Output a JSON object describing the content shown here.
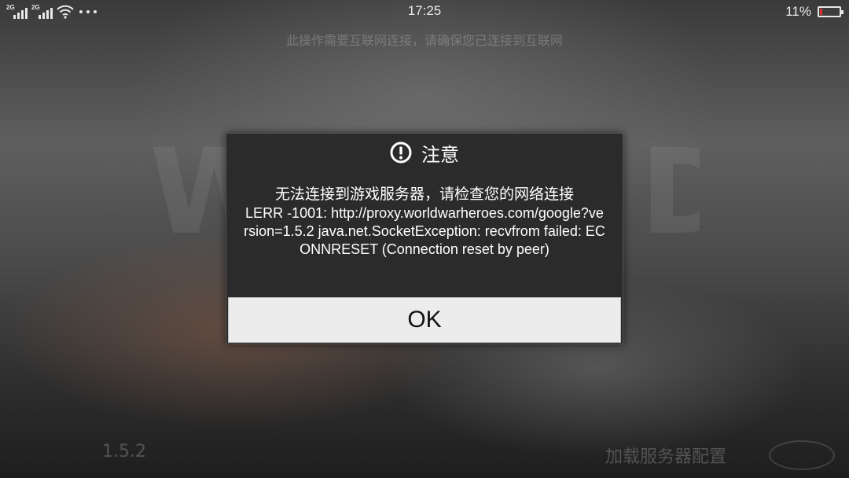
{
  "status_bar": {
    "sim1_network": "2G",
    "sim2_network": "2G",
    "time": "17:25",
    "battery_percent_text": "11%",
    "battery_level": 0.11,
    "battery_color": "#e0302a"
  },
  "background": {
    "notice": "此操作需要互联网连接，请确保您已连接到互联网",
    "watermark": "WORLD WAR",
    "version": "1.5.2",
    "loading_text": "加载服务器配置"
  },
  "dialog": {
    "icon": "alert-circle-icon",
    "title": "注意",
    "message_cn": "无法连接到游戏服务器，请检查您的网络连接",
    "message_en": "LERR -1001: http://proxy.worldwarheroes.com/google?version=1.5.2 java.net.SocketException: recvfrom failed: ECONNRESET (Connection reset by peer)",
    "ok_label": "OK"
  }
}
